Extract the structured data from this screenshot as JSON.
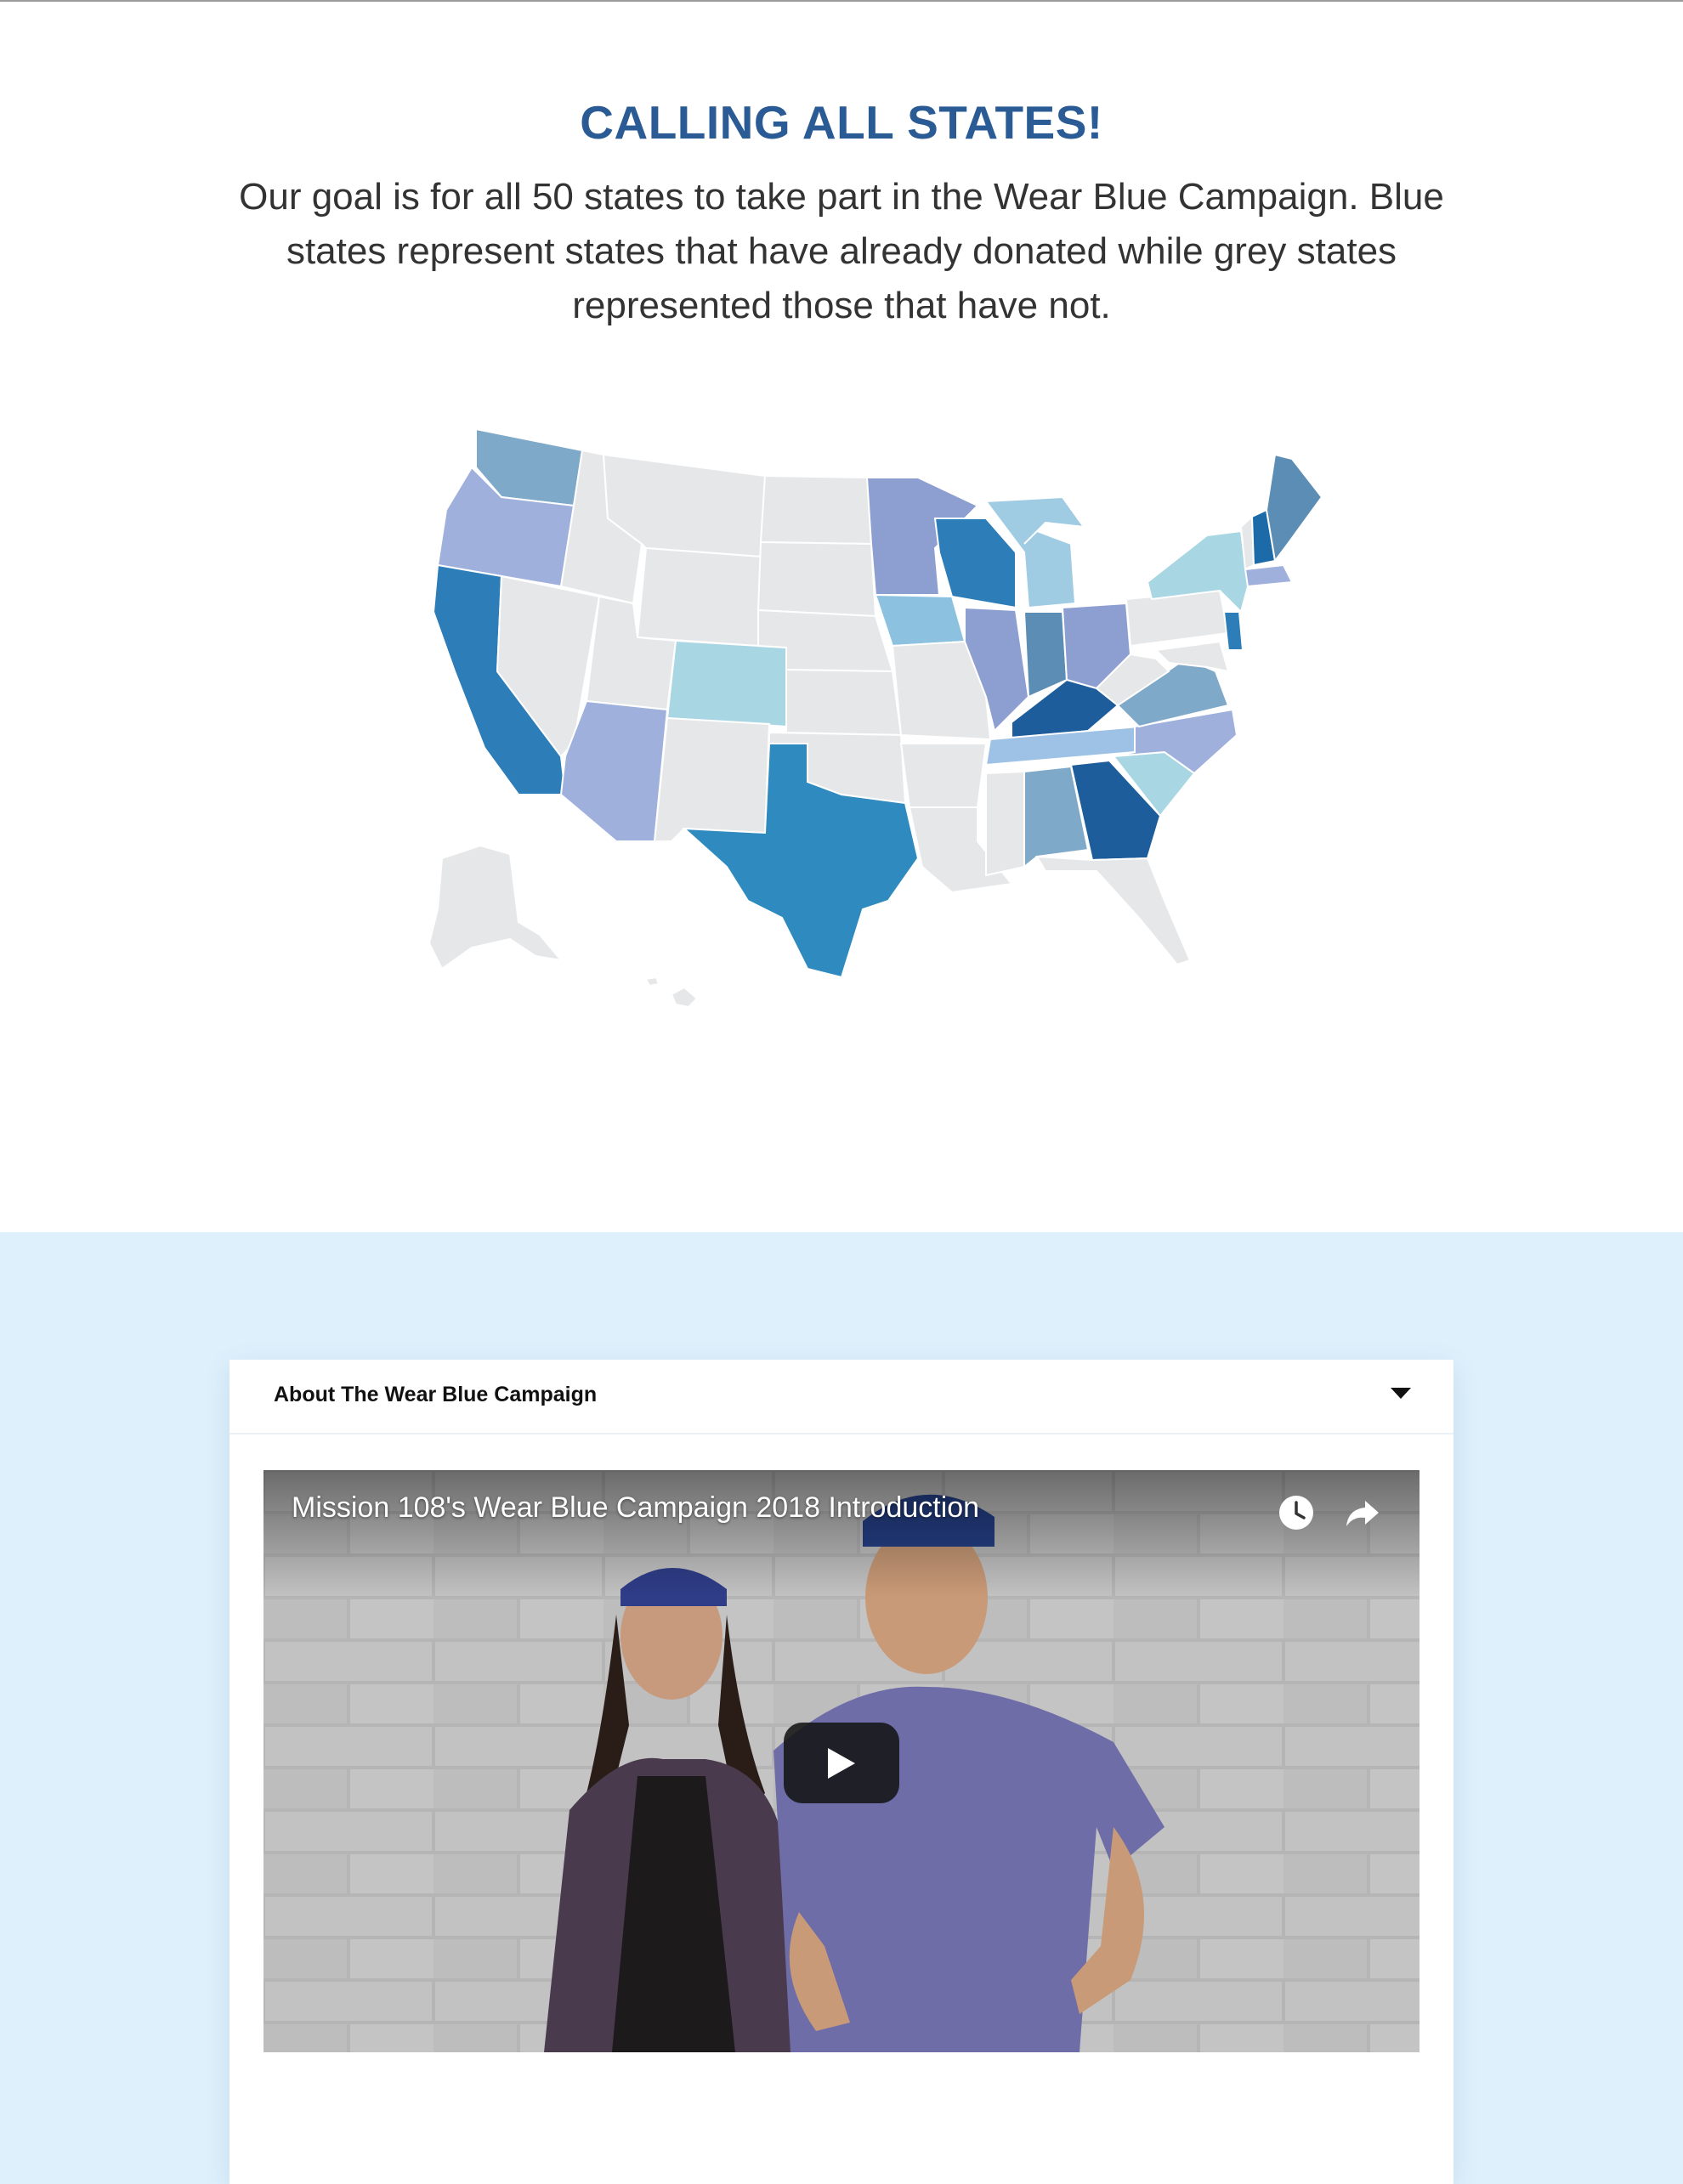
{
  "heading": "CALLING ALL STATES!",
  "intro": "Our goal is for all 50 states to take part in the Wear Blue Campaign. Blue states represent states that have already donated while grey states represented those that have not.",
  "map": {
    "colors": {
      "not_donated": "#e6e7e9",
      "light": "#a9d6e3",
      "mid": "#6fa6cc",
      "lavender": "#9fb0dc",
      "deep": "#2c7db8",
      "navy": "#1d5d9c"
    }
  },
  "accordion": {
    "title": "About The Wear Blue Campaign",
    "expanded": true
  },
  "video": {
    "title": "Mission 108's Wear Blue Campaign 2018 Introduction",
    "icons": [
      "clock-icon",
      "share-icon",
      "play-icon"
    ]
  }
}
